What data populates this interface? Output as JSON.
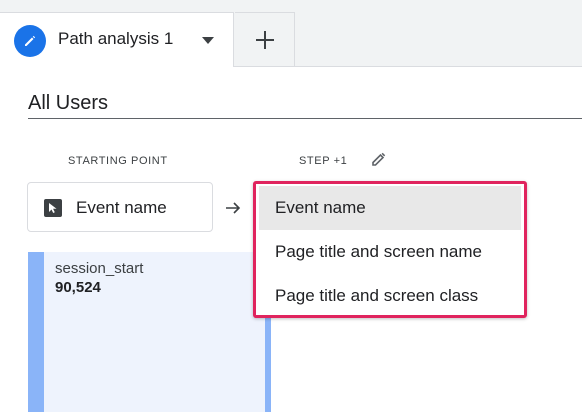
{
  "tabs": {
    "active_label": "Path analysis 1",
    "add_label": "+"
  },
  "segment": {
    "title": "All Users"
  },
  "columns": {
    "starting_point": "STARTING POINT",
    "step": "STEP +1"
  },
  "starting_point": {
    "selector_label": "Event name"
  },
  "node": {
    "name": "session_start",
    "value": "90,524"
  },
  "dropdown": {
    "items": [
      {
        "label": "Event name",
        "selected": true
      },
      {
        "label": "Page title and screen name",
        "selected": false
      },
      {
        "label": "Page title and screen class",
        "selected": false
      }
    ]
  },
  "colors": {
    "accent": "#1a73e8",
    "node_bar": "#8ab4f8",
    "node_bg": "#eef3fd",
    "highlight_border": "#e0245e"
  },
  "icons": [
    "pencil-icon",
    "caret-down-icon",
    "plus-icon",
    "edit-icon",
    "cursor-icon",
    "arrow-right-icon"
  ]
}
